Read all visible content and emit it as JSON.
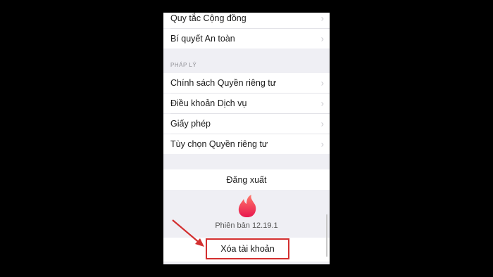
{
  "settings": {
    "top_items": [
      {
        "label": "Quy tắc Cộng đồng"
      },
      {
        "label": "Bí quyết An toàn"
      }
    ],
    "legal_header": "PHÁP LÝ",
    "legal_items": [
      {
        "label": "Chính sách Quyền riêng tư"
      },
      {
        "label": "Điều khoản Dịch vụ"
      },
      {
        "label": "Giấy phép"
      },
      {
        "label": "Tùy chọn Quyền riêng tư"
      }
    ],
    "logout_label": "Đăng xuất",
    "version_text": "Phiên bản 12.19.1",
    "delete_account_label": "Xóa tài khoản"
  },
  "icons": {
    "chevron": "chevron-right-icon",
    "logo": "tinder-flame-icon",
    "annotation": "red-arrow-icon"
  },
  "colors": {
    "background": "#000000",
    "screen_bg": "#efeff4",
    "row_bg": "#ffffff",
    "flame_start": "#ff6b6b",
    "flame_end": "#e8174e",
    "annotation": "#d32f2f"
  }
}
